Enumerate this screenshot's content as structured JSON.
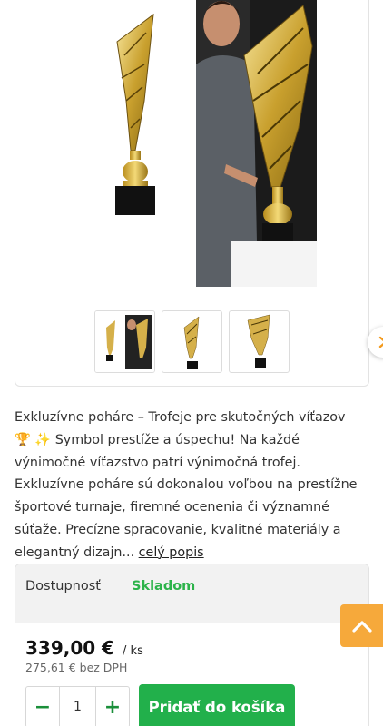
{
  "gallery": {
    "main_image_alt": "Exkluzívne poháre trofej",
    "thumbnails": [
      "thumb-1",
      "thumb-2",
      "thumb-3"
    ],
    "next_icon": "chevron-right-icon"
  },
  "description": {
    "text": "Exkluzívne poháre – Trofeje pre skutočných víťazov 🏆 ✨ Symbol prestíže a úspechu! Na každé výnimočné víťazstvo patrí výnimočná trofej. Exkluzívne poháre sú dokonalou voľbou na prestížne športové turnaje, firemné ocenenia či významné súťaže. Precízne spracovanie, kvalitné materiály a elegantný dizajn...",
    "more_link": "celý popis"
  },
  "buy_box": {
    "availability_label": "Dostupnosť",
    "availability_value": "Skladom",
    "price": "339,00 €",
    "price_unit": "/ ks",
    "price_net": "275,61 € bez DPH",
    "quantity": "1",
    "minus_label": "−",
    "plus_label": "+",
    "add_to_cart": "Pridať do košíka"
  },
  "colors": {
    "accent_green": "#22b04b",
    "availability_green": "#2cb34a",
    "back_to_top": "#f6a93b"
  },
  "back_to_top_icon": "chevron-up-icon"
}
